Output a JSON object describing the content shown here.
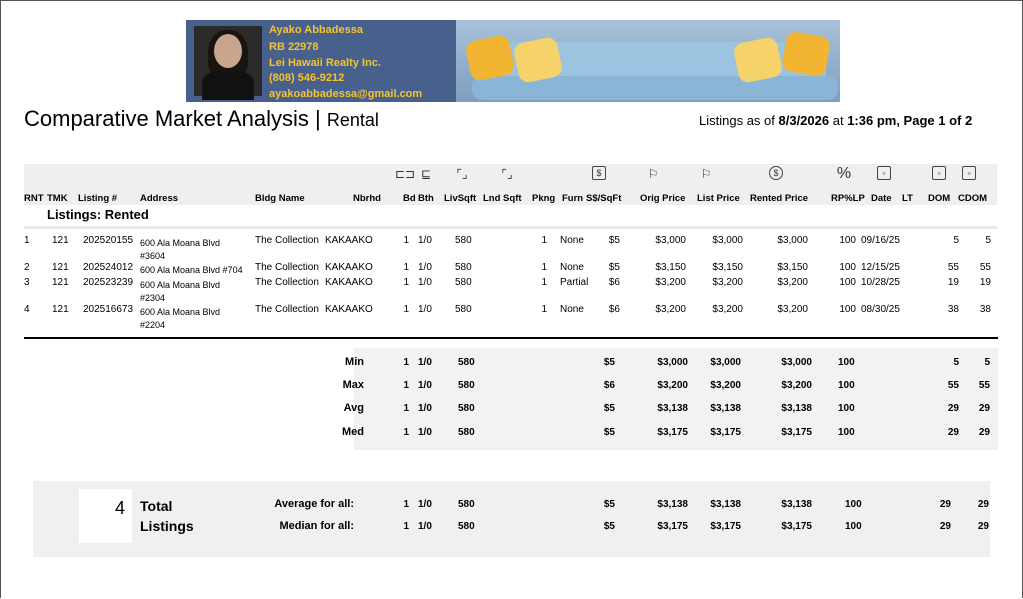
{
  "agent": {
    "name": "Ayako Abbadessa",
    "license": "RB 22978",
    "company": "Lei Hawaii Realty Inc.",
    "phone": "(808) 546-9212",
    "email": "ayakoabbadessa@gmail.com"
  },
  "report": {
    "title": "Comparative Market Analysis",
    "separator": "|",
    "subtitle": "Rental",
    "listings_as_of_prefix": "Listings as of",
    "date": "8/3/2026",
    "at": "at",
    "time_page": "1:36 pm, Page 1 of 2"
  },
  "columns": {
    "rnt": "RNT",
    "tmk": "TMK",
    "listing": "Listing #",
    "address": "Address",
    "bldg": "Bldg Name",
    "nbrhd": "Nbrhd",
    "bd": "Bd",
    "bth": "Bth",
    "livsqft": "LivSqft",
    "lndsqft": "Lnd Sqft",
    "pkng": "Pkng",
    "furn": "Furn",
    "ssqft": "S$/SqFt",
    "orig": "Orig Price",
    "list": "List Price",
    "rented": "Rented Price",
    "rplp": "RP%LP",
    "date": "Date",
    "lt": "LT",
    "dom": "DOM",
    "cdom": "CDOM"
  },
  "header_icons": {
    "bed": "bed-icon",
    "bath": "bath-icon",
    "livsqft": "area-icon",
    "lndsqft": "land-area-icon",
    "ssqft": "dollar-doc-icon",
    "orig": "flag-icon",
    "list": "flag-icon",
    "rented": "dollar-circle-icon",
    "rplp": "percent-icon",
    "calendar": "calendar-icon"
  },
  "section_title": "Listings: Rented",
  "rows": [
    {
      "rnt": "1",
      "tmk": "121",
      "listing": "202520155",
      "addr1": "600 Ala Moana Blvd",
      "addr2": "#3604",
      "bldg": "The Collection",
      "nbrhd": "KAKAAKO",
      "bd": "1",
      "bth": "1/0",
      "livsqft": "580",
      "pkng": "1",
      "furn": "None",
      "ssqft": "$5",
      "orig": "$3,000",
      "list": "$3,000",
      "rented": "$3,000",
      "rplp": "100",
      "date": "09/16/25",
      "dom": "5",
      "cdom": "5"
    },
    {
      "rnt": "2",
      "tmk": "121",
      "listing": "202524012",
      "addr1": "600 Ala Moana Blvd #704",
      "addr2": "",
      "bldg": "The Collection",
      "nbrhd": "KAKAAKO",
      "bd": "1",
      "bth": "1/0",
      "livsqft": "580",
      "pkng": "1",
      "furn": "None",
      "ssqft": "$5",
      "orig": "$3,150",
      "list": "$3,150",
      "rented": "$3,150",
      "rplp": "100",
      "date": "12/15/25",
      "dom": "55",
      "cdom": "55"
    },
    {
      "rnt": "3",
      "tmk": "121",
      "listing": "202523239",
      "addr1": "600 Ala Moana Blvd",
      "addr2": "#2304",
      "bldg": "The Collection",
      "nbrhd": "KAKAAKO",
      "bd": "1",
      "bth": "1/0",
      "livsqft": "580",
      "pkng": "1",
      "furn": "Partial",
      "ssqft": "$6",
      "orig": "$3,200",
      "list": "$3,200",
      "rented": "$3,200",
      "rplp": "100",
      "date": "10/28/25",
      "dom": "19",
      "cdom": "19"
    },
    {
      "rnt": "4",
      "tmk": "121",
      "listing": "202516673",
      "addr1": "600 Ala Moana Blvd",
      "addr2": "#2204",
      "bldg": "The Collection",
      "nbrhd": "KAKAAKO",
      "bd": "1",
      "bth": "1/0",
      "livsqft": "580",
      "pkng": "1",
      "furn": "None",
      "ssqft": "$6",
      "orig": "$3,200",
      "list": "$3,200",
      "rented": "$3,200",
      "rplp": "100",
      "date": "08/30/25",
      "dom": "38",
      "cdom": "38"
    }
  ],
  "stats": [
    {
      "label": "Min",
      "bd": "1",
      "bth": "1/0",
      "livsqft": "580",
      "ssqft": "$5",
      "orig": "$3,000",
      "list": "$3,000",
      "rented": "$3,000",
      "rplp": "100",
      "dom": "5",
      "cdom": "5"
    },
    {
      "label": "Max",
      "bd": "1",
      "bth": "1/0",
      "livsqft": "580",
      "ssqft": "$6",
      "orig": "$3,200",
      "list": "$3,200",
      "rented": "$3,200",
      "rplp": "100",
      "dom": "55",
      "cdom": "55"
    },
    {
      "label": "Avg",
      "bd": "1",
      "bth": "1/0",
      "livsqft": "580",
      "ssqft": "$5",
      "orig": "$3,138",
      "list": "$3,138",
      "rented": "$3,138",
      "rplp": "100",
      "dom": "29",
      "cdom": "29"
    },
    {
      "label": "Med",
      "bd": "1",
      "bth": "1/0",
      "livsqft": "580",
      "ssqft": "$5",
      "orig": "$3,175",
      "list": "$3,175",
      "rented": "$3,175",
      "rplp": "100",
      "dom": "29",
      "cdom": "29"
    }
  ],
  "totals": {
    "count": "4",
    "label1": "Total",
    "label2": "Listings",
    "rows": [
      {
        "label": "Average for all:",
        "bd": "1",
        "bth": "1/0",
        "livsqft": "580",
        "ssqft": "$5",
        "orig": "$3,138",
        "list": "$3,138",
        "rented": "$3,138",
        "rplp": "100",
        "dom": "29",
        "cdom": "29"
      },
      {
        "label": "Median for all:",
        "bd": "1",
        "bth": "1/0",
        "livsqft": "580",
        "ssqft": "$5",
        "orig": "$3,175",
        "list": "$3,175",
        "rented": "$3,175",
        "rplp": "100",
        "dom": "29",
        "cdom": "29"
      }
    ]
  },
  "colors": {
    "banner_text": "#f4c430",
    "band": "#efefef",
    "pillow": "#f2b531"
  }
}
